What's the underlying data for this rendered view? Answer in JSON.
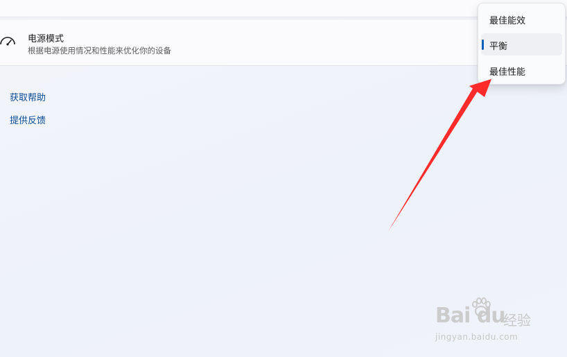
{
  "power_mode": {
    "title": "电源模式",
    "description": "根据电源使用情况和性能来优化你的设备",
    "icon": "speedometer-icon"
  },
  "links": {
    "get_help": "获取帮助",
    "give_feedback": "提供反馈"
  },
  "dropdown": {
    "options": [
      {
        "label": "最佳能效",
        "selected": false
      },
      {
        "label": "平衡",
        "selected": true
      },
      {
        "label": "最佳性能",
        "selected": false
      }
    ],
    "accent_color": "#005fb8"
  },
  "annotation": {
    "arrow_color": "#ff2a2a"
  },
  "watermark": {
    "brand": "Bai du",
    "cn": "经验",
    "url": "jingyan.baidu.com"
  },
  "colors": {
    "link": "#0a4b94",
    "background": "#eef2f9"
  }
}
